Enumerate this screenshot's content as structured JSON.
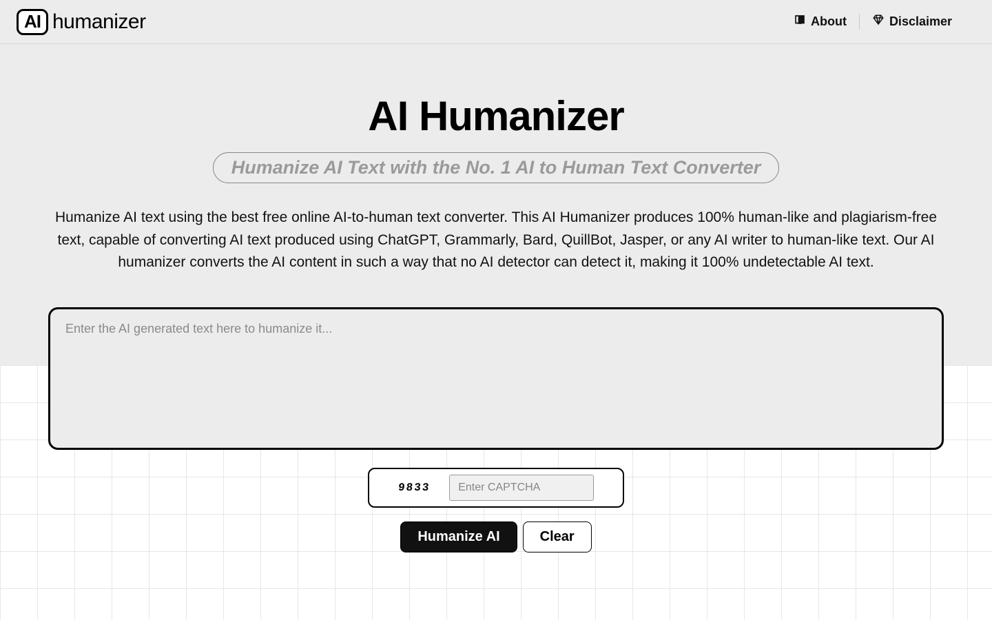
{
  "logo": {
    "box": "AI",
    "word": "humanizer"
  },
  "nav": {
    "about": "About",
    "disclaimer": "Disclaimer"
  },
  "hero": {
    "title": "AI Humanizer",
    "tagline": "Humanize AI Text with the No. 1 AI to Human Text Converter",
    "description": "Humanize AI text using the best free online AI-to-human text converter. This AI Humanizer produces 100% human-like and plagiarism-free text, capable of converting AI text produced using ChatGPT, Grammarly, Bard, QuillBot, Jasper, or any AI writer to human-like text. Our AI humanizer converts the AI content in such a way that no AI detector can detect it, making it 100% undetectable AI text."
  },
  "editor": {
    "placeholder": "Enter the AI generated text here to humanize it...",
    "value": ""
  },
  "captcha": {
    "code": "9833",
    "placeholder": "Enter CAPTCHA",
    "value": ""
  },
  "buttons": {
    "primary": "Humanize AI",
    "clear": "Clear"
  }
}
